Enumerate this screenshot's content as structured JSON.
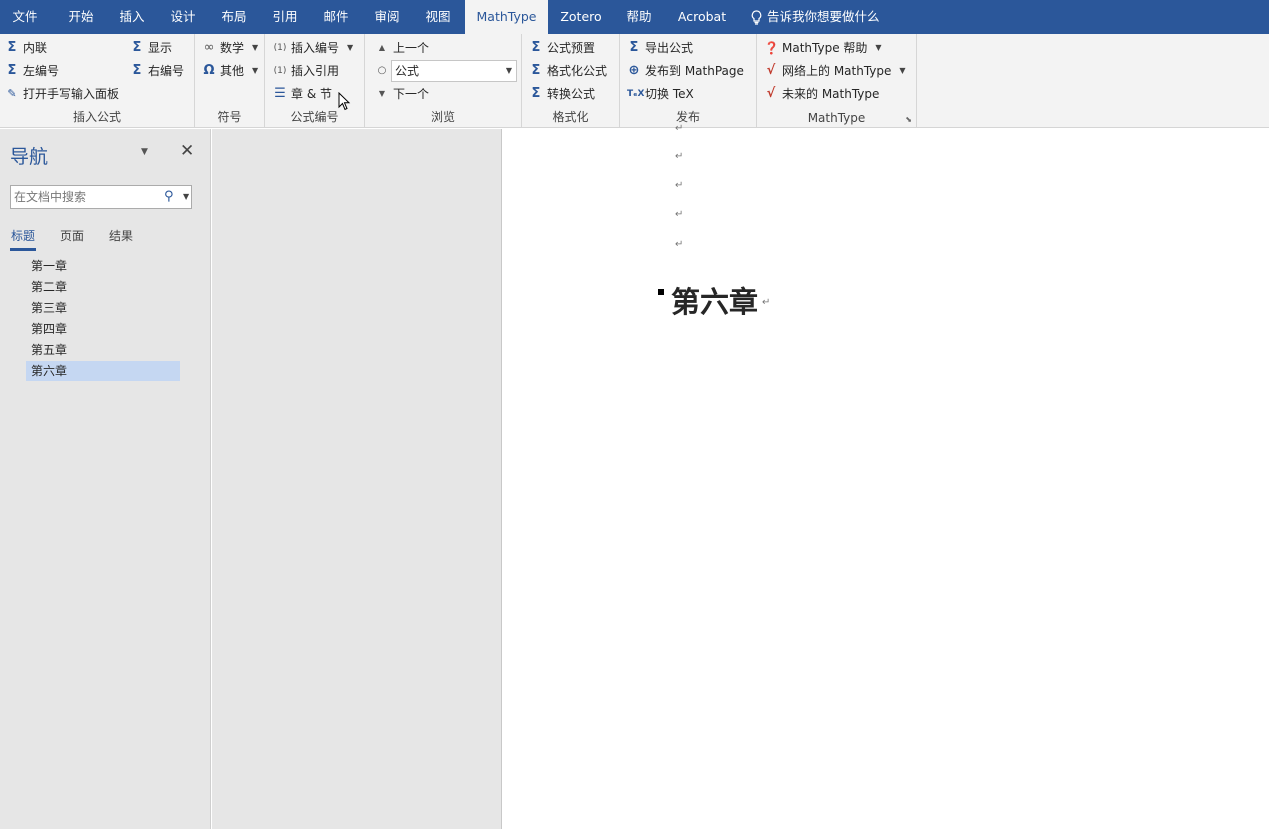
{
  "tabs": [
    "文件",
    "开始",
    "插入",
    "设计",
    "布局",
    "引用",
    "邮件",
    "审阅",
    "视图",
    "MathType",
    "Zotero",
    "帮助",
    "Acrobat"
  ],
  "active_tab": "MathType",
  "tell_me": "告诉我你想要做什么",
  "ribbon": {
    "insert_equation": {
      "label": "插入公式",
      "inline": "内联",
      "display": "显示",
      "left_number": "左编号",
      "right_number": "右编号",
      "handwriting": "打开手写输入面板"
    },
    "symbols": {
      "label": "符号",
      "math": "数学",
      "other": "其他"
    },
    "equation_numbers": {
      "label": "公式编号",
      "insert_number": "插入编号",
      "insert_reference": "插入引用",
      "chapter_section": "章 & 节"
    },
    "browse": {
      "label": "浏览",
      "previous": "上一个",
      "combo_value": "公式",
      "next": "下一个"
    },
    "format": {
      "label": "格式化",
      "preset": "公式预置",
      "format_eq": "格式化公式",
      "convert": "转换公式"
    },
    "publish": {
      "label": "发布",
      "export": "导出公式",
      "publish_mathpage": "发布到 MathPage",
      "toggle_tex": "切换 TeX"
    },
    "mathtype": {
      "label": "MathType",
      "help": "MathType 帮助",
      "online": "网络上的 MathType",
      "future": "未来的 MathType"
    }
  },
  "nav": {
    "title": "导航",
    "search_placeholder": "在文档中搜索",
    "tabs": [
      "标题",
      "页面",
      "结果"
    ],
    "active_tab": "标题",
    "headings": [
      "第一章",
      "第二章",
      "第三章",
      "第四章",
      "第五章",
      "第六章"
    ],
    "selected_heading": "第六章"
  },
  "document": {
    "paragraph_mark": "↵",
    "heading": "第六章"
  }
}
